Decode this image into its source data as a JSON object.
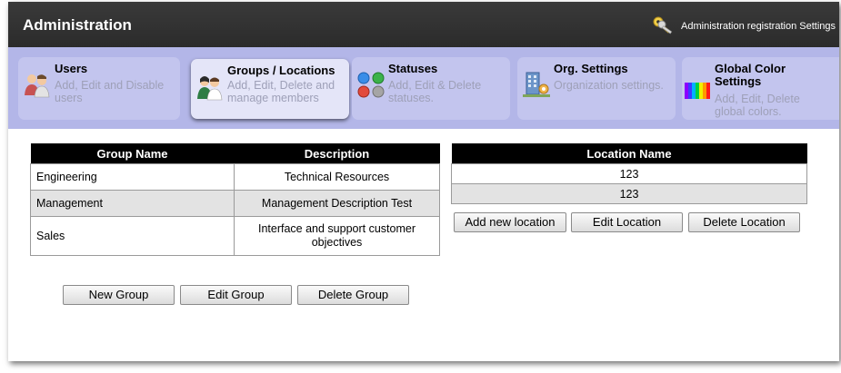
{
  "window": {
    "title": "Administration"
  },
  "header": {
    "registration_link": "Administration registration Settings"
  },
  "tabs": [
    {
      "title": "Users",
      "desc": "Add, Edit and Disable users"
    },
    {
      "title": "Groups / Locations",
      "desc": "Add, Edit, Delete and manage members"
    },
    {
      "title": "Statuses",
      "desc": "Add, Edit & Delete statuses."
    },
    {
      "title": "Org. Settings",
      "desc": "Organization settings."
    },
    {
      "title": "Global Color Settings",
      "desc": "Add, Edit, Delete global colors."
    }
  ],
  "groups_table": {
    "headers": [
      "Group Name",
      "Description"
    ],
    "rows": [
      {
        "name": "Engineering",
        "desc": "Technical Resources"
      },
      {
        "name": "Management",
        "desc": "Management Description Test"
      },
      {
        "name": "Sales",
        "desc": "Interface and support customer objectives"
      }
    ]
  },
  "locations_table": {
    "header": "Location Name",
    "rows": [
      "123",
      "123"
    ]
  },
  "group_buttons": {
    "new": "New Group",
    "edit": "Edit Group",
    "delete": "Delete Group"
  },
  "location_buttons": {
    "add": "Add new location",
    "edit": "Edit Location",
    "delete": "Delete Location"
  },
  "colors": {
    "titlebar": "#2f2f2f",
    "navbar": "#b3b6e8",
    "tab": "#c3c5ee",
    "tab_active": "#e4e5f8"
  }
}
